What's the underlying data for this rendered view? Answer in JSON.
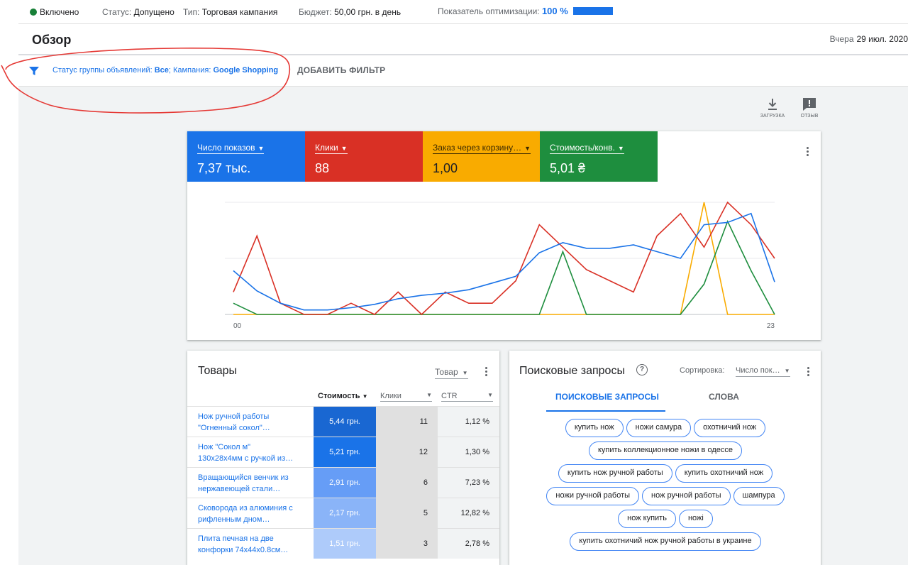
{
  "status_bar": {
    "enabled_label": "Включено",
    "status_label": "Статус:",
    "status_value": "Допущено",
    "type_label": "Тип:",
    "type_value": "Торговая кампания",
    "budget_label": "Бюджет:",
    "budget_value": "50,00 грн. в день",
    "optimization_label": "Показатель оптимизации:",
    "optimization_value": "100 %",
    "optimization_score": 100,
    "colors": {
      "enabled": "#188038",
      "accent": "#1a73e8"
    }
  },
  "header": {
    "title": "Обзор",
    "date_label": "Вчера",
    "date_value": "29 июл. 2020"
  },
  "filter": {
    "icon": "filter-icon",
    "text_1": "Статус группы объявлений:",
    "value_1": "Все",
    "text_2": "; Кампания:",
    "value_2": "Google Shopping",
    "add_filter_label": "ДОБАВИТЬ ФИЛЬТР"
  },
  "toolbar": {
    "download_label": "ЗАГРУЗКА",
    "feedback_label": "ОТЗЫВ"
  },
  "metrics": [
    {
      "label": "Число показов",
      "value": "7,37 тыс.",
      "color": "#1a73e8"
    },
    {
      "label": "Клики",
      "value": "88",
      "color": "#d93025"
    },
    {
      "label": "Заказ через корзину…",
      "value": "1,00",
      "color": "#f9ab00"
    },
    {
      "label": "Стоимость/конв.",
      "value": "5,01 ₴",
      "color": "#1e8e3e"
    }
  ],
  "chart_data": {
    "type": "line",
    "x": [
      0,
      1,
      2,
      3,
      4,
      5,
      6,
      7,
      8,
      9,
      10,
      11,
      12,
      13,
      14,
      15,
      16,
      17,
      18,
      19,
      20,
      21,
      22,
      23
    ],
    "x_tick_labels": [
      "00",
      "23"
    ],
    "grid": true,
    "ylim": [
      0,
      100
    ],
    "series": [
      {
        "name": "Число показов",
        "color": "#1a73e8",
        "values": [
          39,
          21,
          10,
          4,
          4,
          6,
          9,
          14,
          17,
          19,
          22,
          28,
          34,
          55,
          64,
          59,
          59,
          62,
          56,
          50,
          80,
          82,
          90,
          29
        ]
      },
      {
        "name": "Клики",
        "color": "#d93025",
        "values": [
          20,
          70,
          10,
          0,
          0,
          10,
          0,
          20,
          0,
          20,
          10,
          10,
          30,
          80,
          60,
          40,
          30,
          20,
          70,
          90,
          60,
          100,
          80,
          50
        ]
      },
      {
        "name": "Заказ через корзину…",
        "color": "#f9ab00",
        "values": [
          0,
          0,
          0,
          0,
          0,
          0,
          0,
          0,
          0,
          0,
          0,
          0,
          0,
          0,
          0,
          0,
          0,
          0,
          0,
          0,
          100,
          0,
          0,
          0
        ]
      },
      {
        "name": "Стоимость/конв.",
        "color": "#1e8e3e",
        "values": [
          10,
          0,
          0,
          0,
          0,
          0,
          0,
          0,
          0,
          0,
          0,
          0,
          0,
          0,
          56,
          0,
          0,
          0,
          0,
          0,
          27,
          83,
          39,
          0
        ]
      }
    ]
  },
  "products": {
    "title": "Товары",
    "dropdown_value": "Товар",
    "columns": [
      "Стоимость",
      "Клики",
      "CTR"
    ],
    "rows": [
      {
        "name_line1": "Нож ручной работы",
        "name_line2": "\"Огненный сокол\"…",
        "cost": "5,44 грн.",
        "cost_color": "#1967d2",
        "clicks": "11",
        "ctr": "1,12 %"
      },
      {
        "name_line1": "Нож \"Сокол м\"",
        "name_line2": "130х28х4мм с ручкой из…",
        "cost": "5,21 грн.",
        "cost_color": "#1a73e8",
        "clicks": "12",
        "ctr": "1,30 %"
      },
      {
        "name_line1": "Вращающийся венчик из",
        "name_line2": "нержавеющей стали…",
        "cost": "2,91 грн.",
        "cost_color": "#669df6",
        "clicks": "6",
        "ctr": "7,23 %"
      },
      {
        "name_line1": "Сковорода из алюминия с",
        "name_line2": "рифленным дном…",
        "cost": "2,17 грн.",
        "cost_color": "#8ab4f8",
        "clicks": "5",
        "ctr": "12,82 %"
      },
      {
        "name_line1": "Плита печная на две",
        "name_line2": "конфорки 74х44х0.8см…",
        "cost": "1,51 грн.",
        "cost_color": "#aecbfa",
        "clicks": "3",
        "ctr": "2,78 %"
      }
    ]
  },
  "search": {
    "title": "Поисковые запросы",
    "sort_label": "Сортировка:",
    "sort_value": "Число пок…",
    "tabs": [
      "ПОИСКОВЫЕ ЗАПРОСЫ",
      "СЛОВА"
    ],
    "chips": [
      [
        "купить нож",
        "ножи самура",
        "охотничий нож"
      ],
      [
        "купить коллекционное ножи в одессе"
      ],
      [
        "купить нож ручной работы",
        "купить охотничий нож"
      ],
      [
        "ножи ручной работы",
        "нож ручной работы",
        "шампура"
      ],
      [
        "нож купить",
        "ножі"
      ],
      [
        "купить охотничий нож ручной работы в украине"
      ]
    ]
  }
}
